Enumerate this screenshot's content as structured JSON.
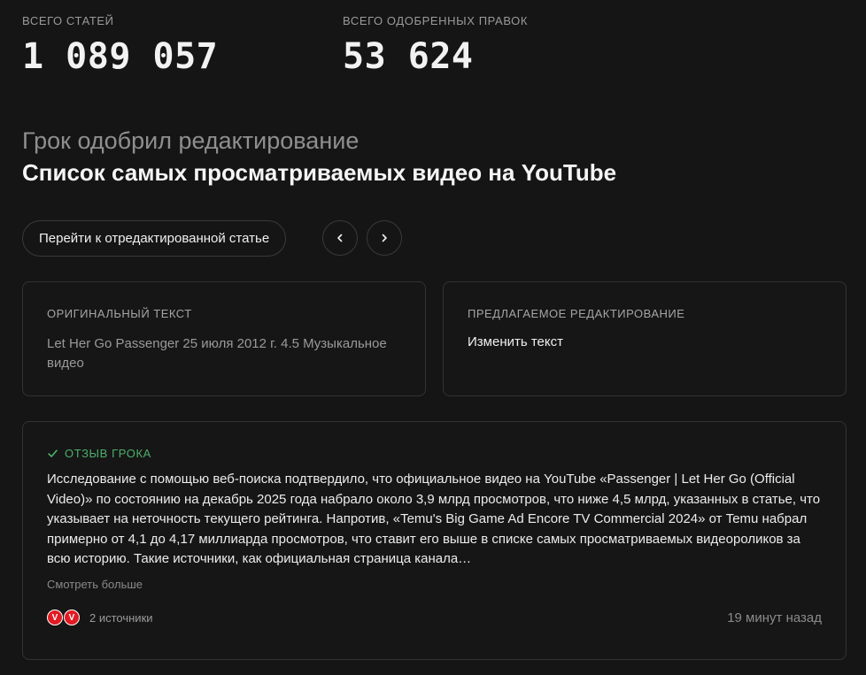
{
  "stats": {
    "total_articles_label": "ВСЕГО СТАТЕЙ",
    "total_articles_value": "1 089 057",
    "approved_edits_label": "ВСЕГО ОДОБРЕННЫХ ПРАВОК",
    "approved_edits_value": "53 624"
  },
  "header": {
    "subtitle": "Грок одобрил редактирование",
    "title": "Список самых просматриваемых видео на YouTube"
  },
  "actions": {
    "go_to_article": "Перейти к отредактированной статье",
    "prev_icon": "chevron-left-icon",
    "next_icon": "chevron-right-icon"
  },
  "original": {
    "label": "ОРИГИНАЛЬНЫЙ ТЕКСТ",
    "text": "Let Her Go Passenger 25 июля 2012 г. 4.5 Музыкальное видео"
  },
  "proposed": {
    "label": "ПРЕДЛАГАЕМОЕ РЕДАКТИРОВАНИЕ",
    "text": "Изменить текст"
  },
  "review": {
    "icon": "check-icon",
    "label": "ОТЗЫВ ГРОКА",
    "text": "Исследование с помощью веб-поиска подтвердило, что официальное видео на YouTube «Passenger | Let Her Go (Official Video)» по состоянию на декабрь 2025 года набрало около 3,9 млрд просмотров, что ниже 4,5 млрд, указанных в статье, что указывает на неточность текущего рейтинга. Напротив, «Temu's Big Game Ad Encore TV Commercial 2024» от Temu набрал примерно от 4,1 до 4,17 миллиарда просмотров, что ставит его выше в списке самых просматриваемых видеороликов за всю историю. Такие источники, как официальная страница канала…",
    "see_more": "Смотреть больше",
    "source_icon_letter": "V",
    "sources_count": "2 источники",
    "time_ago": "19 минут назад"
  },
  "colors": {
    "background": "#151515",
    "accent_green": "#4caf6a",
    "source_red": "#e21a23"
  }
}
